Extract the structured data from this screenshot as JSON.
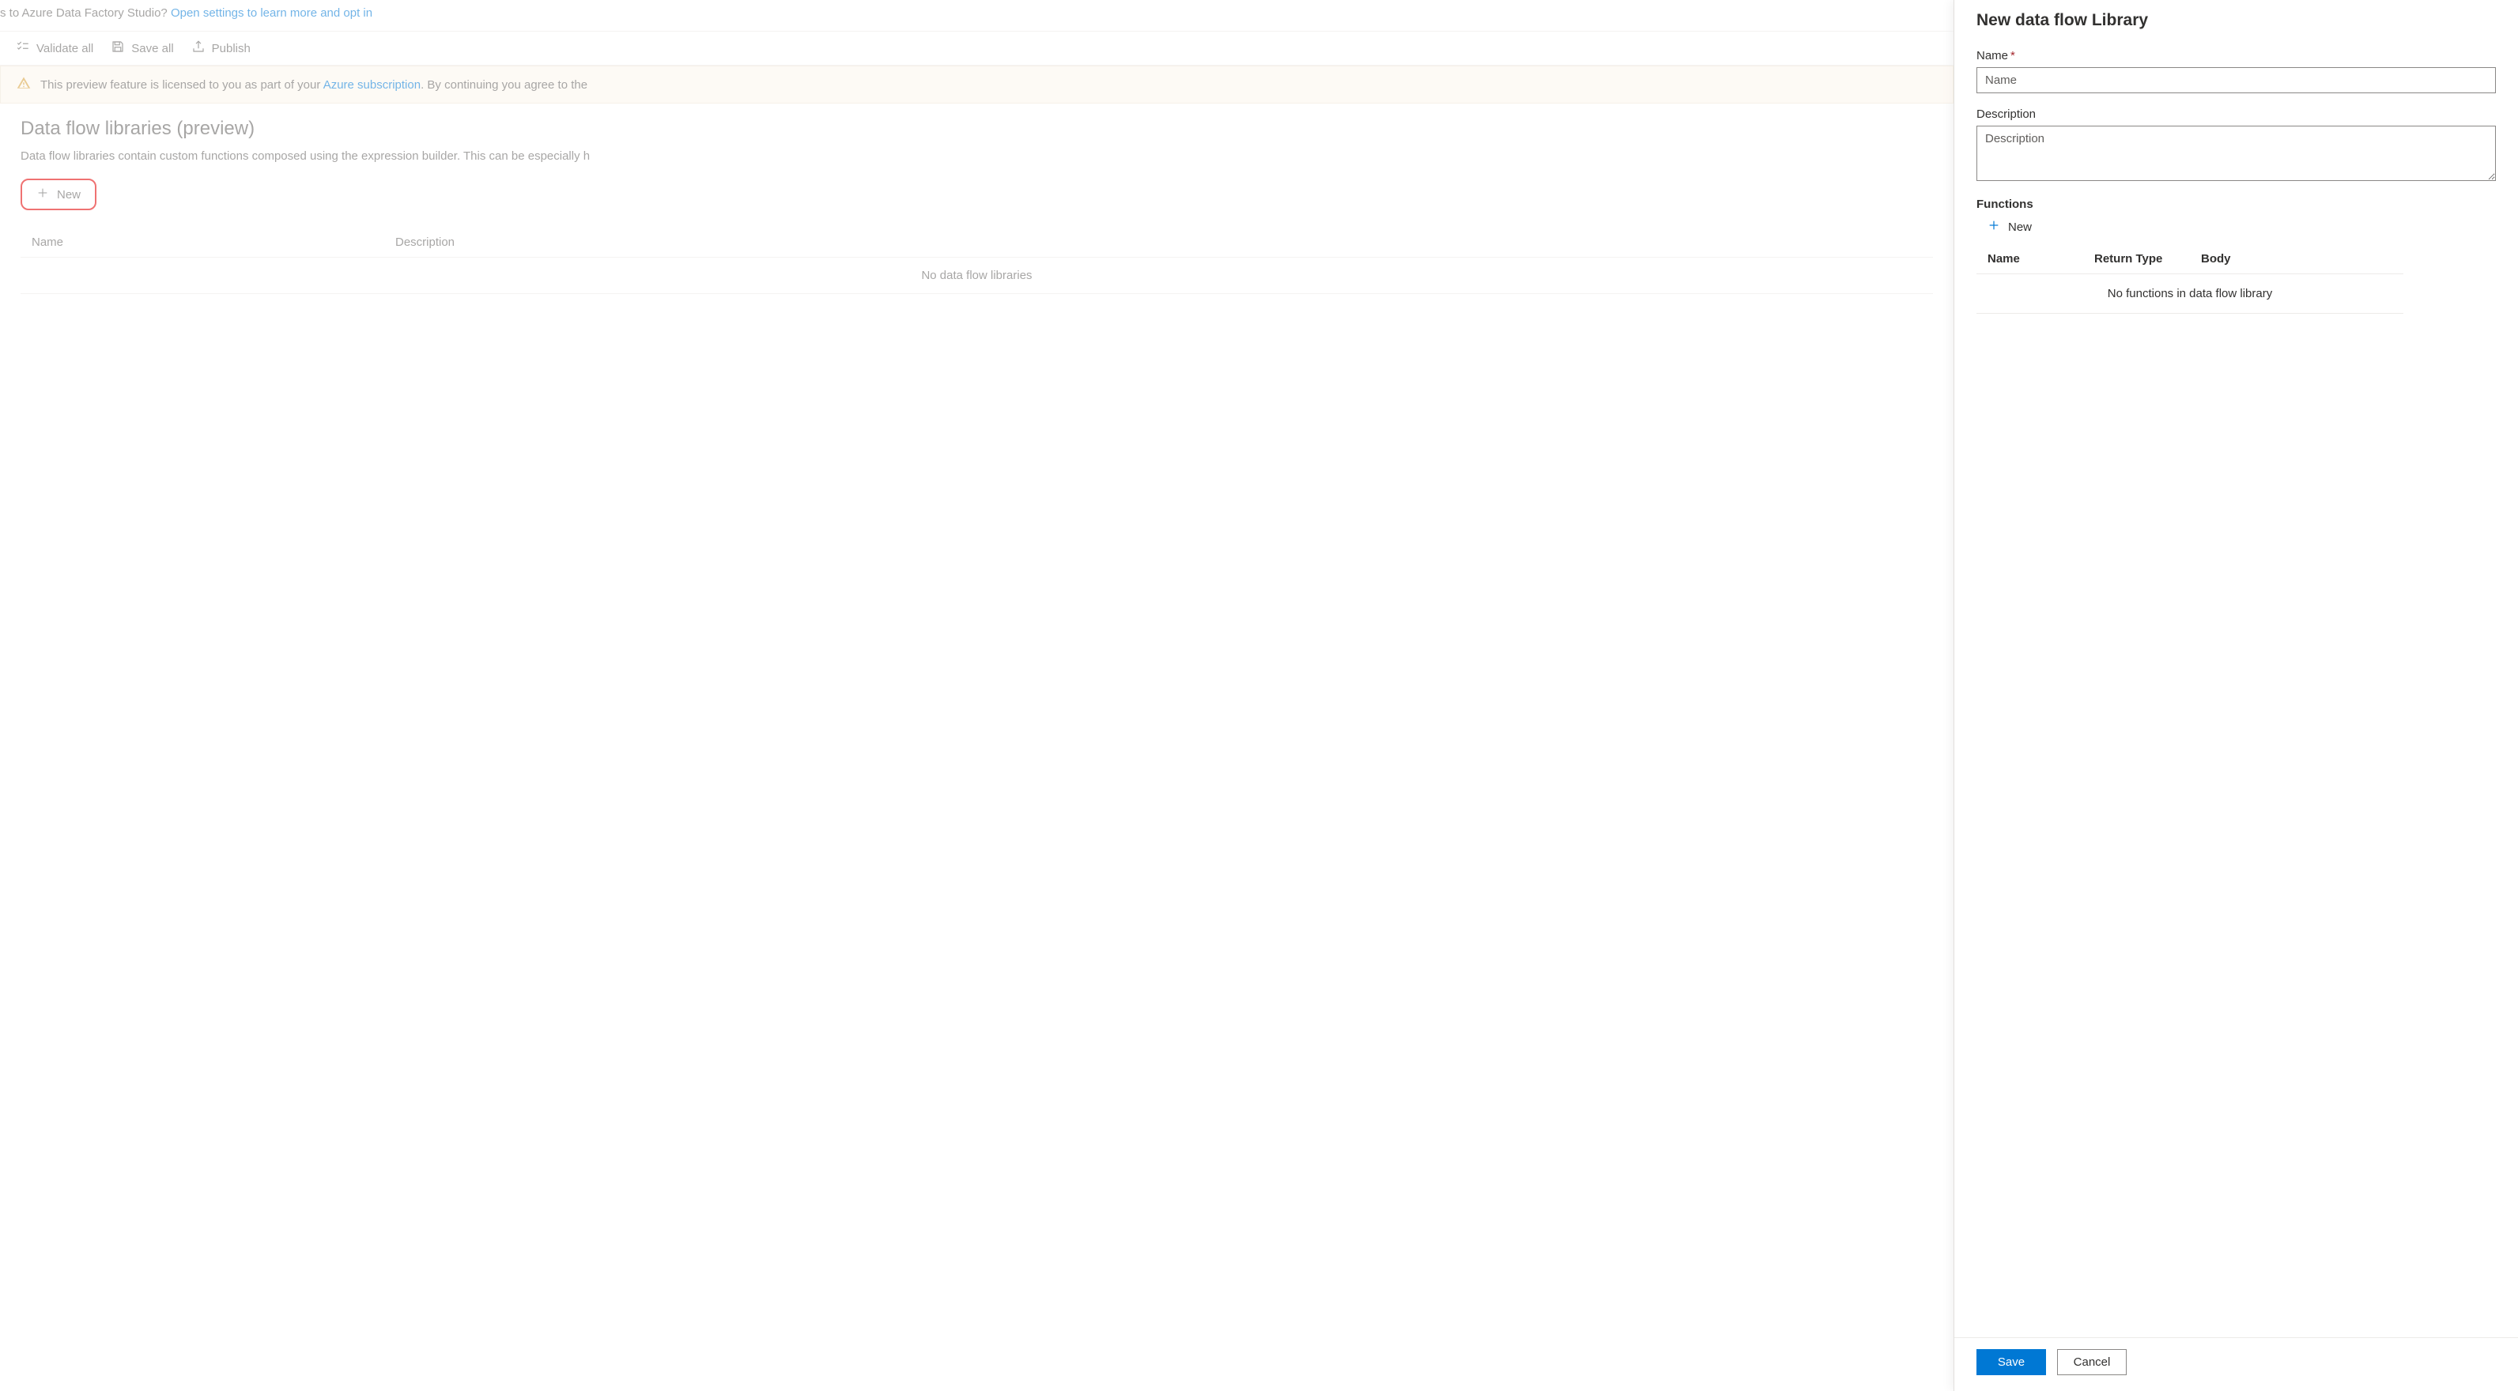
{
  "top_banner": {
    "prefix": "s to Azure Data Factory Studio? ",
    "link": "Open settings to learn more and opt in"
  },
  "toolbar": {
    "validate_all": "Validate all",
    "save_all": "Save all",
    "publish": "Publish"
  },
  "info_banner": {
    "text_before": "This preview feature is licensed to you as part of your ",
    "link": "Azure subscription",
    "text_after": ". By continuing you agree to the"
  },
  "page": {
    "title": "Data flow libraries (preview)",
    "description": "Data flow libraries contain custom functions composed using the expression builder. This can be especially h",
    "new_label": "New",
    "table": {
      "col_name": "Name",
      "col_description": "Description",
      "empty": "No data flow libraries"
    }
  },
  "panel": {
    "title": "New data flow Library",
    "name_label": "Name",
    "name_placeholder": "Name",
    "description_label": "Description",
    "description_placeholder": "Description",
    "functions_label": "Functions",
    "fn_new_label": "New",
    "fn_table": {
      "col_name": "Name",
      "col_return": "Return Type",
      "col_body": "Body",
      "empty": "No functions in data flow library"
    },
    "save": "Save",
    "cancel": "Cancel"
  }
}
